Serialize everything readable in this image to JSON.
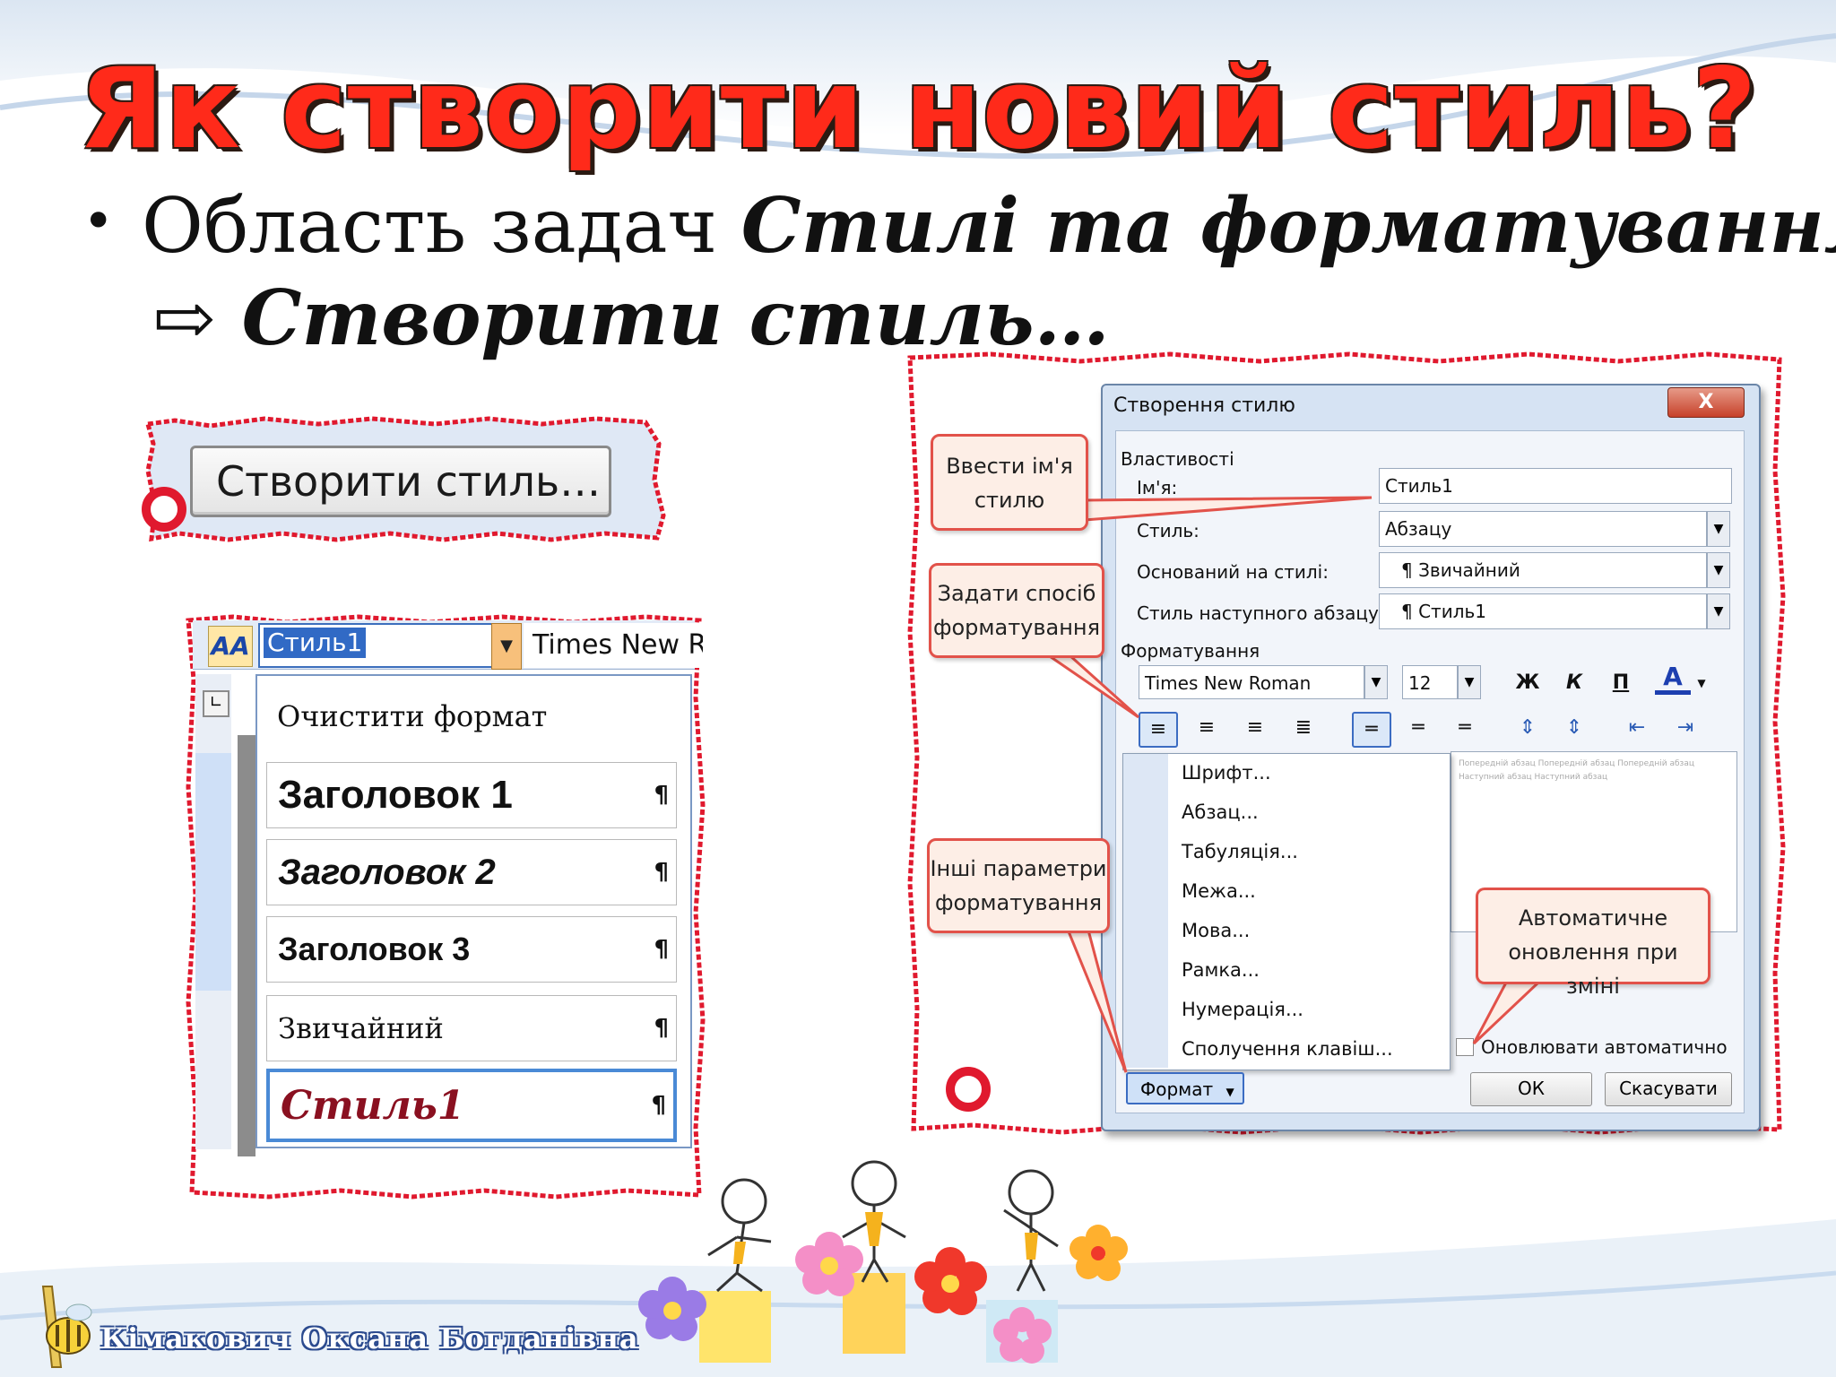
{
  "slide": {
    "title": "Як створити новий стиль?",
    "bullet_prefix": "Область задач ",
    "bullet_italic": "Стилі та форматування",
    "bullet_arrow": "⇨",
    "bullet_line2": "Створити стиль…",
    "author": "Кімакович Оксана Богданівна"
  },
  "create_button": {
    "label": "Створити стиль…"
  },
  "style_dropdown": {
    "aa_icon": "AA",
    "selected_style": "Стиль1",
    "font_value": "Times New Ro",
    "items": [
      {
        "label": "Очистити формат"
      },
      {
        "label": "Заголовок 1",
        "mark": "¶"
      },
      {
        "label": "Заголовок 2",
        "mark": "¶"
      },
      {
        "label": "Заголовок 3",
        "mark": "¶"
      },
      {
        "label": "Звичайний",
        "mark": "¶"
      },
      {
        "label": "Стиль1",
        "mark": "¶"
      }
    ]
  },
  "dialog": {
    "title": "Створення стилю",
    "close_label": "X",
    "properties_header": "Властивості",
    "name_label": "Ім'я:",
    "name_value": "Стиль1",
    "type_label": "Стиль:",
    "type_value": "Абзацу",
    "based_on_label": "Оснований на стилі:",
    "based_on_value": "¶ Звичайний",
    "next_label": "Стиль наступного абзацу:",
    "next_value": "¶ Стиль1",
    "formatting_header": "Форматування",
    "font_value": "Times New Roman",
    "size_value": "12",
    "bold": "Ж",
    "italic": "К",
    "underline": "П",
    "font_color": "A",
    "preview_text": "Попередній абзац Попередній абзац Попередній абзац Наступний абзац Наступний абзац",
    "format_menu": [
      "Шрифт...",
      "Абзац...",
      "Табуляція...",
      "Межа...",
      "Мова...",
      "Рамка...",
      "Нумерація...",
      "Сполучення клавіш..."
    ],
    "format_button": "Формат",
    "auto_update_label": "Оновлювати автоматично",
    "ok_label": "ОК",
    "cancel_label": "Скасувати"
  },
  "callouts": {
    "enter_name": "Ввести ім'я стилю",
    "set_format": "Задати спосіб форматування",
    "other_params": "Інші параметри форматування",
    "auto_update": "Автоматичне оновлення при зміні"
  },
  "colors": {
    "title": "#ff2a1a",
    "accent_red": "#e0192e",
    "dialog_bg": "#d6e3f3"
  }
}
